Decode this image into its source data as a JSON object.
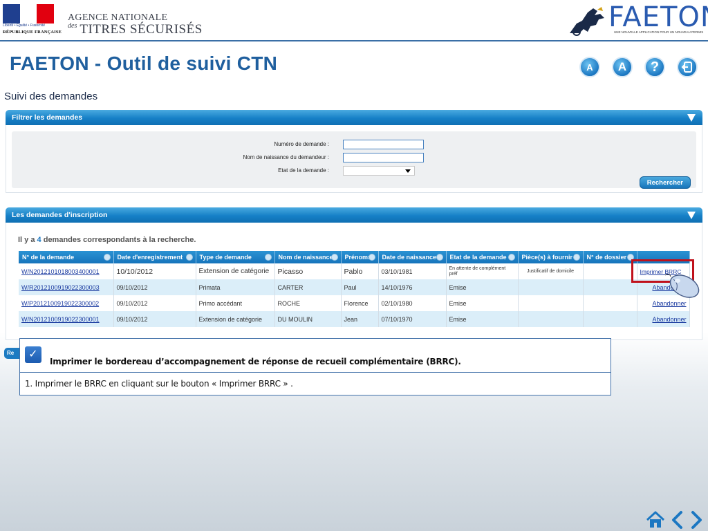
{
  "header": {
    "rf_motto": "Liberté • Égalité • Fraternité",
    "rf_name": "RÉPUBLIQUE FRANÇAISE",
    "agency_line1": "AGENCE NATIONALE",
    "agency_des": "des",
    "agency_line2": "TITRES SÉCURISÉS",
    "faeton_word": "FAETON",
    "faeton_tagline": "UNE NOUVELLE APPLICATION POUR UN NOUVEAU PERMIS"
  },
  "app_title": "FAETON - Outil de suivi CTN",
  "toolbar": {
    "font_small_label": "A",
    "font_large_label": "A",
    "help_label": "?"
  },
  "page": {
    "section_title": "Suivi des demandes"
  },
  "filter": {
    "panel_title": "Filtrer les demandes",
    "fields": {
      "numero_label": "Numéro de demande :",
      "nom_label": "Nom de naissance du demandeur :",
      "etat_label": "Etat de la demande :"
    },
    "values": {
      "numero": "",
      "nom": "",
      "etat": ""
    },
    "search_button": "Rechercher"
  },
  "results": {
    "panel_title": "Les demandes d'inscription",
    "count_prefix": "Il y a",
    "count": "4",
    "count_suffix": "demandes correspondants à la recherche.",
    "columns": [
      "N° de la demande",
      "Date d'enregistrement",
      "Type de demande",
      "Nom de naissance",
      "Prénoms",
      "Date de naissance",
      "Etat de la demande",
      "Pièce(s) à fournir",
      "N° de dossier",
      ""
    ],
    "rows": [
      {
        "numero": "W/N2012101018003400001",
        "date_enreg": "10/10/2012",
        "type": "Extension de catégorie",
        "nom": "Picasso",
        "prenom": "Pablo",
        "date_naiss": "03/10/1981",
        "etat": "En attente de complément préf",
        "pieces": "Justificatif de domicile",
        "dossier": "",
        "action": "Imprimer BRRC"
      },
      {
        "numero": "W/R2012100919022300003",
        "date_enreg": "09/10/2012",
        "type": "Primata",
        "nom": "CARTER",
        "prenom": "Paul",
        "date_naiss": "14/10/1976",
        "etat": "Emise",
        "pieces": "",
        "dossier": "",
        "action": "Abandonner"
      },
      {
        "numero": "W/P2012100919022300002",
        "date_enreg": "09/10/2012",
        "type": "Primo accédant",
        "nom": "ROCHE",
        "prenom": "Florence",
        "date_naiss": "02/10/1980",
        "etat": "Emise",
        "pieces": "",
        "dossier": "",
        "action": "Abandonner"
      },
      {
        "numero": "W/N2012100919022300001",
        "date_enreg": "09/10/2012",
        "type": "Extension de catégorie",
        "nom": "DU MOULIN",
        "prenom": "Jean",
        "date_naiss": "07/10/1970",
        "etat": "Emise",
        "pieces": "",
        "dossier": "",
        "action": "Abandonner"
      }
    ]
  },
  "partial_button_label": "Re",
  "instruction": {
    "title": "Imprimer le bordereau d’accompagnement de réponse de recueil complémentaire (BRRC).",
    "step": "1.   Imprimer le  BRRC en cliquant sur le  bouton « Imprimer BRRC » ."
  },
  "icons": {
    "font_small": "font-decrease-icon",
    "font_large": "font-increase-icon",
    "help": "help-icon",
    "logout": "logout-icon",
    "check": "checkbox-icon",
    "mouse": "mouse-icon",
    "home": "home-icon",
    "prev": "chevron-left-icon",
    "next": "chevron-right-icon"
  },
  "colors": {
    "brand_blue": "#1f5f9e",
    "panel_blue": "#1680c7",
    "link": "#1a3aa0",
    "highlight": "#c0111b"
  }
}
